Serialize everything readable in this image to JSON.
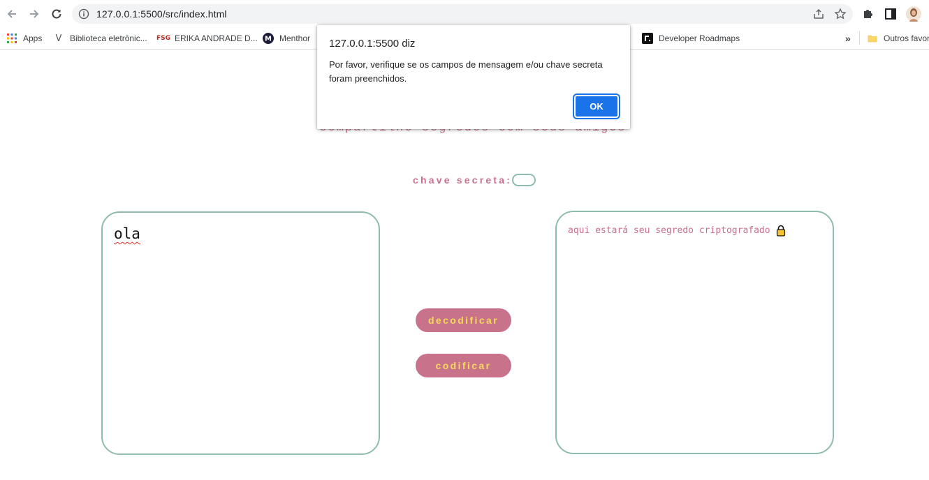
{
  "browser": {
    "url": "127.0.0.1:5500/src/index.html",
    "bookmarks": [
      {
        "label": "Apps",
        "icon": "apps-grid-icon"
      },
      {
        "label": "Biblioteca eletrônic...",
        "icon": "v-logo-icon"
      },
      {
        "label": "ERIKA ANDRADE D...",
        "icon": "fsg-logo-icon"
      },
      {
        "label": "Menthor",
        "icon": "menthor-logo-icon"
      },
      {
        "label": "Developer Roadmaps",
        "icon": "roadmap-logo-icon"
      }
    ],
    "more_label": "»",
    "other_bookmarks": "Outros favor"
  },
  "page": {
    "subtitle": "compartilhe segredos com seus amigos",
    "secret_key_label": "chave secreta:",
    "input_text": "ola",
    "output_placeholder": "aqui estará seu segredo criptografado",
    "decode_button": "decodificar",
    "encode_button": "codificar"
  },
  "dialog": {
    "title": "127.0.0.1:5500 diz",
    "message": "Por favor, verifique se os campos de mensagem e/ou chave secreta foram preenchidos.",
    "ok_label": "OK"
  },
  "colors": {
    "accent_pink": "#c96f8b",
    "button_pink": "#c8728c",
    "button_text_yellow": "#f5d957",
    "border_green": "#8fbcab",
    "dialog_blue": "#1a73e8"
  }
}
